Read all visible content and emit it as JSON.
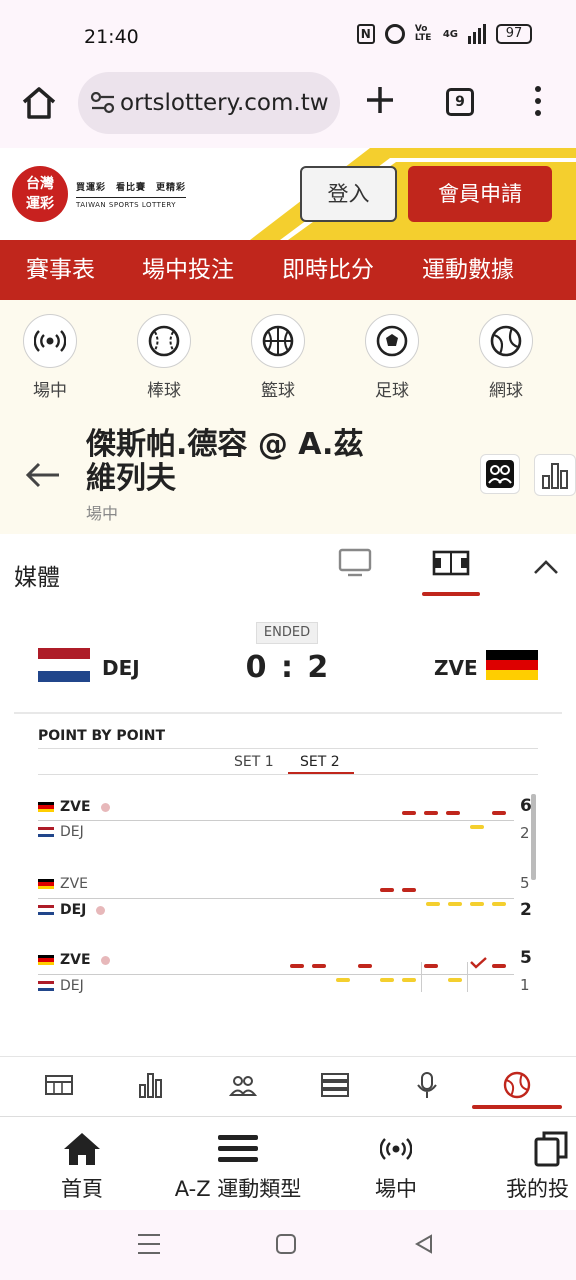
{
  "status_bar": {
    "time": "21:40",
    "network": "4G",
    "battery": "97"
  },
  "browser": {
    "url": "ortslottery.com.tw",
    "tab_count": "9"
  },
  "site_header": {
    "logo_text_line1": "台灣",
    "logo_text_line2": "運彩",
    "slogan": "買運彩　看比賽　更精彩",
    "logo_english": "TAIWAN SPORTS LOTTERY",
    "login_label": "登入",
    "register_label": "會員申請"
  },
  "main_nav": {
    "items": [
      {
        "label": "賽事表"
      },
      {
        "label": "場中投注"
      },
      {
        "label": "即時比分"
      },
      {
        "label": "運動數據"
      }
    ]
  },
  "sports": {
    "items": [
      {
        "label": "場中",
        "icon": "live-broadcast-icon"
      },
      {
        "label": "棒球",
        "icon": "baseball-icon"
      },
      {
        "label": "籃球",
        "icon": "basketball-icon"
      },
      {
        "label": "足球",
        "icon": "soccer-icon"
      },
      {
        "label": "網球",
        "icon": "tennis-icon"
      }
    ]
  },
  "match": {
    "title": "傑斯帕.德容 @ A.茲維列夫",
    "status": "場中"
  },
  "media": {
    "label": "媒體"
  },
  "scoreboard": {
    "status": "ENDED",
    "home_code": "DEJ",
    "away_code": "ZVE",
    "score": "0 : 2",
    "home_flag_colors": [
      "#ae1c28",
      "#ffffff",
      "#21468b"
    ],
    "away_flag_colors": [
      "#000000",
      "#dd0000",
      "#ffce00"
    ]
  },
  "point_by_point": {
    "title": "POINT BY POINT",
    "sets": [
      {
        "label": "SET 1"
      },
      {
        "label": "SET 2"
      }
    ],
    "active_set": "SET 2",
    "games": [
      {
        "rows": [
          {
            "player": "ZVE",
            "bold": true,
            "serving": true,
            "score": "6",
            "flag": "de"
          },
          {
            "player": "DEJ",
            "bold": false,
            "serving": false,
            "score": "2",
            "flag": "nl"
          }
        ]
      },
      {
        "rows": [
          {
            "player": "ZVE",
            "bold": false,
            "serving": false,
            "score": "5",
            "flag": "de"
          },
          {
            "player": "DEJ",
            "bold": true,
            "serving": true,
            "score": "2",
            "flag": "nl"
          }
        ]
      },
      {
        "rows": [
          {
            "player": "ZVE",
            "bold": true,
            "serving": true,
            "score": "5",
            "flag": "de"
          },
          {
            "player": "DEJ",
            "bold": false,
            "serving": false,
            "score": "1",
            "flag": "nl"
          }
        ]
      }
    ]
  },
  "bottom_nav": {
    "items": [
      {
        "label": "首頁",
        "icon": "home-icon"
      },
      {
        "label": "A-Z 運動類型",
        "icon": "menu-icon"
      },
      {
        "label": "場中",
        "icon": "live-broadcast-icon"
      },
      {
        "label": "我的投",
        "icon": "copy-icon"
      }
    ]
  },
  "colors": {
    "brand_red": "#c0261c",
    "accent_yellow": "#f4cf2e",
    "beige_bg": "#fdfaee"
  }
}
